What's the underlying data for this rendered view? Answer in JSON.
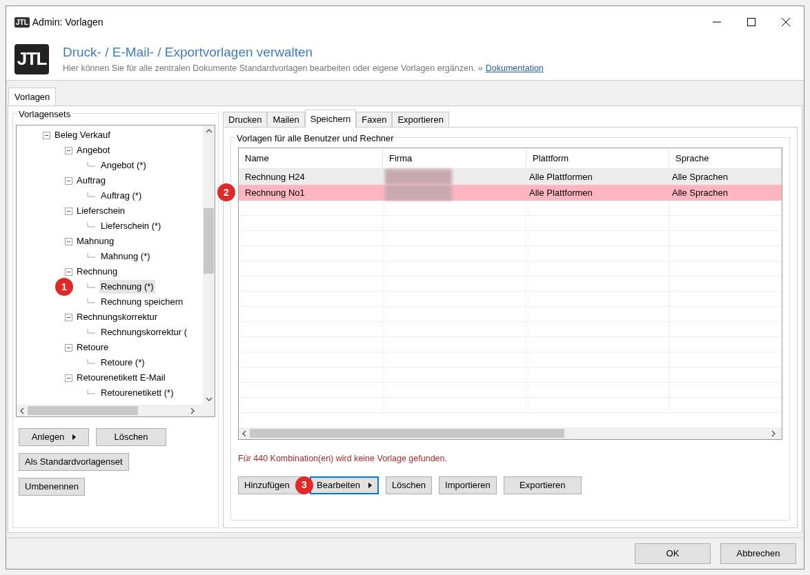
{
  "window": {
    "title": "Admin: Vorlagen",
    "icon_text": "JTL"
  },
  "header": {
    "logo": "JTL",
    "title": "Druck- / E-Mail- / Exportvorlagen verwalten",
    "subtitle": "Hier können Sie für alle zentralen Dokumente Standardvorlagen bearbeiten oder eigene Vorlagen ergänzen. »",
    "link": "Dokumentation"
  },
  "main_tabs": [
    {
      "label": "Vorlagen",
      "selected": true
    }
  ],
  "vorlagensets": {
    "title": "Vorlagensets",
    "tree": [
      {
        "label": "Beleg Verkauf",
        "expanded": true,
        "selected": false,
        "children": [
          {
            "label": "Angebot",
            "expanded": true,
            "selected": false,
            "children": [
              {
                "label": "Angebot (*)",
                "selected": false
              }
            ]
          },
          {
            "label": "Auftrag",
            "expanded": true,
            "selected": false,
            "children": [
              {
                "label": "Auftrag (*)",
                "selected": false
              }
            ]
          },
          {
            "label": "Lieferschein",
            "expanded": true,
            "selected": false,
            "children": [
              {
                "label": "Lieferschein (*)",
                "selected": false
              }
            ]
          },
          {
            "label": "Mahnung",
            "expanded": true,
            "selected": false,
            "children": [
              {
                "label": "Mahnung (*)",
                "selected": false
              }
            ]
          },
          {
            "label": "Rechnung",
            "expanded": true,
            "selected": false,
            "children": [
              {
                "label": "Rechnung (*)",
                "selected": true
              },
              {
                "label": "Rechnung speichern",
                "selected": false
              }
            ]
          },
          {
            "label": "Rechnungskorrektur",
            "expanded": true,
            "selected": false,
            "children": [
              {
                "label": "Rechnungskorrektur (",
                "selected": false
              }
            ]
          },
          {
            "label": "Retoure",
            "expanded": true,
            "selected": false,
            "children": [
              {
                "label": "Retoure (*)",
                "selected": false
              }
            ]
          },
          {
            "label": "Retourenetikett E-Mail",
            "expanded": true,
            "selected": false,
            "children": [
              {
                "label": "Retourenetikett (*)",
                "selected": false
              }
            ]
          }
        ]
      }
    ],
    "buttons": [
      {
        "label": "Anlegen",
        "dropdown": true
      },
      {
        "label": "Löschen",
        "dropdown": false
      },
      {
        "label": "Als Standardvorlagenset",
        "dropdown": false
      },
      {
        "label": "Umbenennen",
        "dropdown": false
      }
    ]
  },
  "output_tabs": [
    {
      "label": "Drucken",
      "selected": false
    },
    {
      "label": "Mailen",
      "selected": false
    },
    {
      "label": "Speichern",
      "selected": true
    },
    {
      "label": "Faxen",
      "selected": false
    },
    {
      "label": "Exportieren",
      "selected": false
    }
  ],
  "templates": {
    "title": "Vorlagen für alle Benutzer und Rechner",
    "columns": [
      "Name",
      "Firma",
      "Plattform",
      "Sprache"
    ],
    "rows": [
      {
        "name": "Rechnung H24",
        "firma_redacted": true,
        "plattform": "Alle Plattformen",
        "sprache": "Alle Sprachen",
        "selected": false
      },
      {
        "name": "Rechnung No1",
        "firma_redacted": true,
        "plattform": "Alle Plattformen",
        "sprache": "Alle Sprachen",
        "selected": true
      }
    ],
    "warning": "Für 440 Kombination(en) wird keine Vorlage gefunden.",
    "buttons": [
      {
        "label": "Hinzufügen",
        "dropdown": false,
        "focused": false
      },
      {
        "label": "Bearbeiten",
        "dropdown": true,
        "focused": true
      },
      {
        "label": "Löschen",
        "dropdown": false,
        "focused": false
      },
      {
        "label": "Importieren",
        "dropdown": false,
        "focused": false
      },
      {
        "label": "Exportieren",
        "dropdown": false,
        "focused": false
      }
    ]
  },
  "annotations": [
    {
      "label": "1"
    },
    {
      "label": "2"
    },
    {
      "label": "3"
    }
  ],
  "footer_buttons": [
    "OK",
    "Abbrechen"
  ]
}
